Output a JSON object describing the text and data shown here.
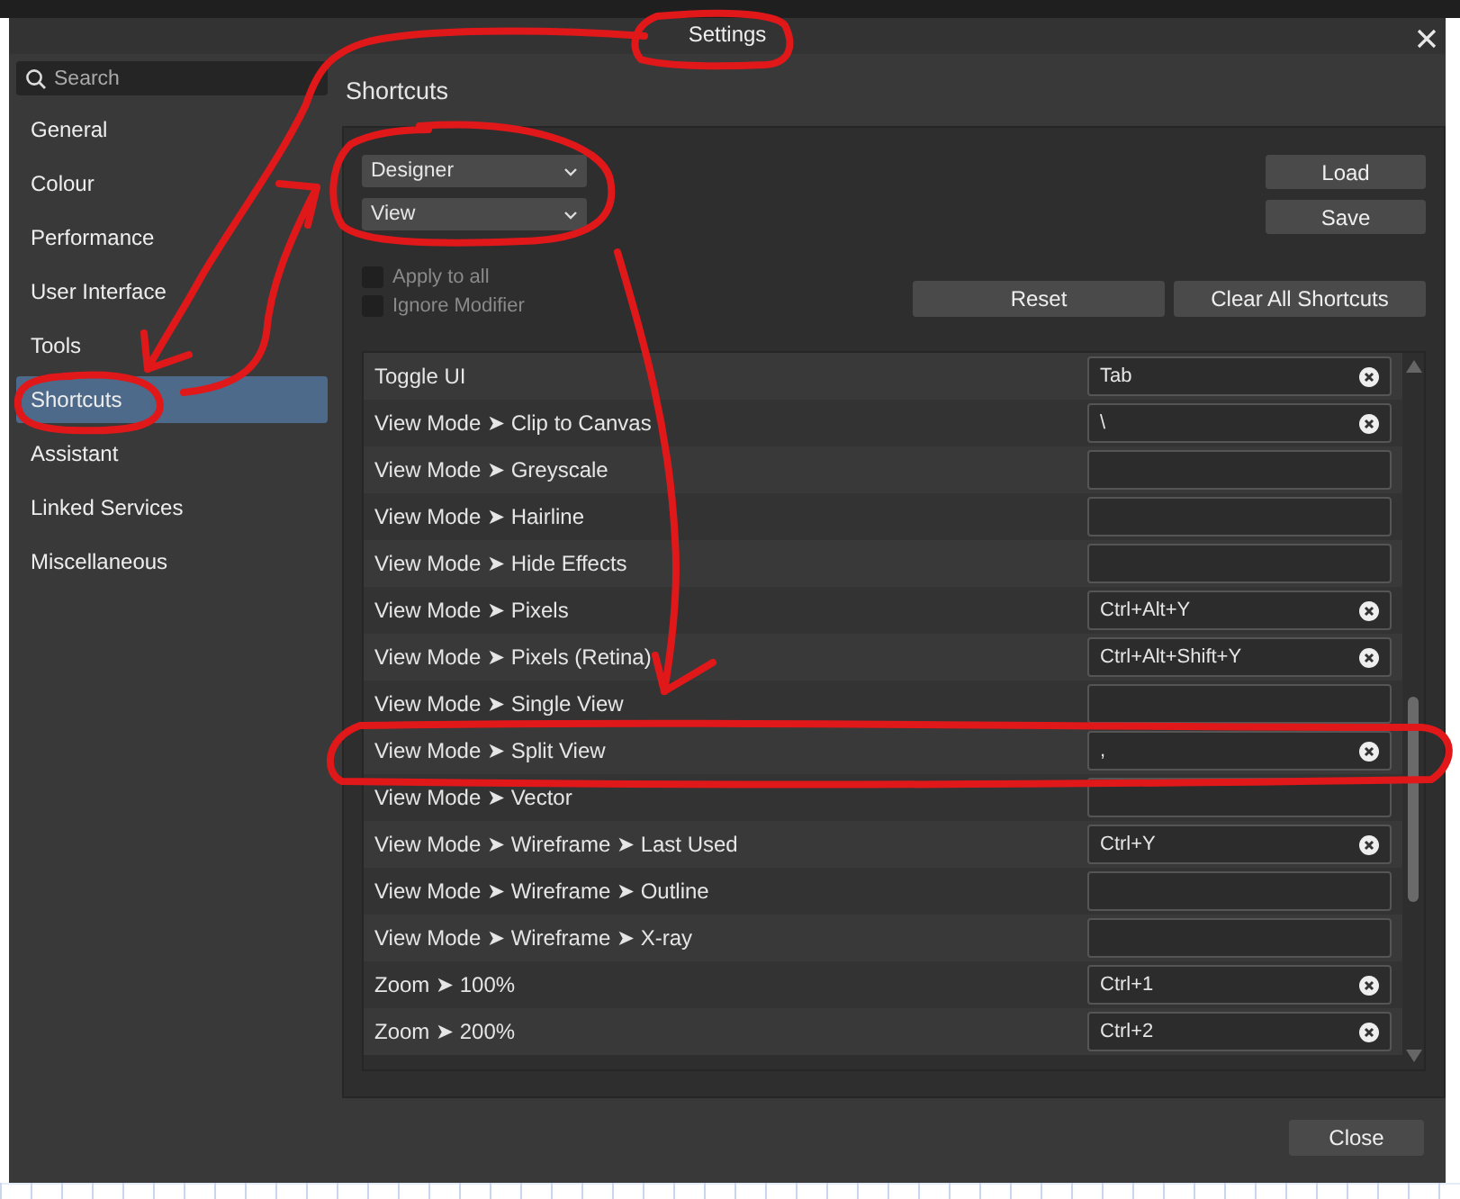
{
  "window": {
    "title": "Settings"
  },
  "sidebar": {
    "search": {
      "placeholder": "Search"
    },
    "items": [
      {
        "label": "General",
        "selected": false
      },
      {
        "label": "Colour",
        "selected": false
      },
      {
        "label": "Performance",
        "selected": false
      },
      {
        "label": "User Interface",
        "selected": false
      },
      {
        "label": "Tools",
        "selected": false
      },
      {
        "label": "Shortcuts",
        "selected": true
      },
      {
        "label": "Assistant",
        "selected": false
      },
      {
        "label": "Linked Services",
        "selected": false
      },
      {
        "label": "Miscellaneous",
        "selected": false
      }
    ]
  },
  "section_title": "Shortcuts",
  "dropdowns": [
    {
      "value": "Designer"
    },
    {
      "value": "View"
    }
  ],
  "file_buttons": [
    "Load",
    "Save"
  ],
  "options": [
    {
      "label": "Apply to all",
      "checked": false,
      "disabled": true
    },
    {
      "label": "Ignore Modifier",
      "checked": false,
      "disabled": true
    }
  ],
  "action_buttons": [
    "Reset",
    "Clear All Shortcuts"
  ],
  "shortcuts": [
    {
      "label": "Toggle UI",
      "shortcut": "Tab"
    },
    {
      "label": "View Mode ➤ Clip to Canvas",
      "shortcut": "\\"
    },
    {
      "label": "View Mode ➤ Greyscale"
    },
    {
      "label": "View Mode ➤ Hairline"
    },
    {
      "label": "View Mode ➤ Hide Effects"
    },
    {
      "label": "View Mode ➤ Pixels",
      "shortcut": "Ctrl+Alt+Y"
    },
    {
      "label": "View Mode ➤ Pixels (Retina)",
      "shortcut": "Ctrl+Alt+Shift+Y"
    },
    {
      "label": "View Mode ➤ Single View"
    },
    {
      "label": "View Mode ➤ Split View",
      "shortcut": ","
    },
    {
      "label": "View Mode ➤ Vector"
    },
    {
      "label": "View Mode ➤ Wireframe ➤ Last Used",
      "shortcut": "Ctrl+Y"
    },
    {
      "label": "View Mode ➤ Wireframe ➤ Outline"
    },
    {
      "label": "View Mode ➤ Wireframe ➤ X-ray"
    },
    {
      "label": "Zoom ➤ 100%",
      "shortcut": "Ctrl+1"
    },
    {
      "label": "Zoom ➤ 200%",
      "shortcut": "Ctrl+2"
    }
  ],
  "close_button": "Close"
}
